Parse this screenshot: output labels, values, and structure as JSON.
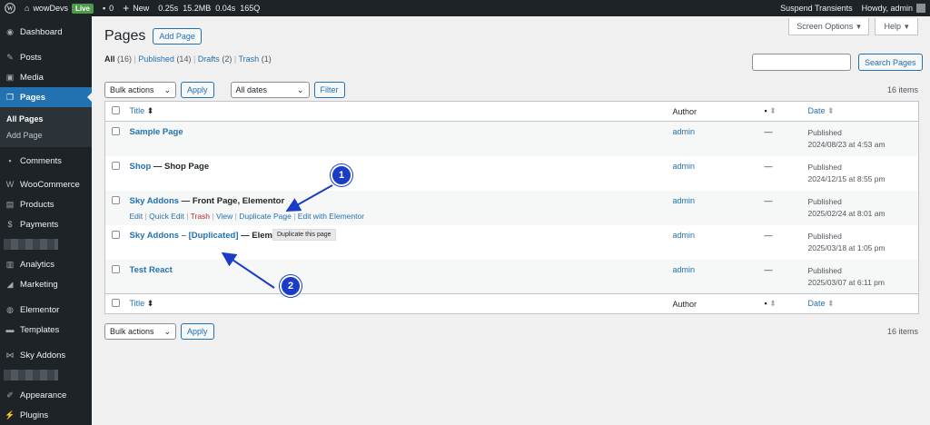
{
  "adminbar": {
    "site_name": "wowDevs",
    "live_badge": "Live",
    "comments_count": "0",
    "new_label": "New",
    "perf": "0.25s  15.2MB  0.04s  165Q",
    "suspend": "Suspend Transients",
    "howdy": "Howdy, admin"
  },
  "sidebar": {
    "dashboard": "Dashboard",
    "posts": "Posts",
    "media": "Media",
    "pages": "Pages",
    "sub_all": "All Pages",
    "sub_add": "Add Page",
    "comments": "Comments",
    "woocommerce": "WooCommerce",
    "products": "Products",
    "payments": "Payments",
    "analytics": "Analytics",
    "marketing": "Marketing",
    "elementor": "Elementor",
    "templates": "Templates",
    "skyaddons": "Sky Addons",
    "appearance": "Appearance",
    "plugins": "Plugins"
  },
  "header": {
    "title": "Pages",
    "add_button": "Add Page",
    "screen_options": "Screen Options",
    "help": "Help"
  },
  "filters": {
    "all": "All",
    "all_count": "(16)",
    "published": "Published",
    "published_count": "(14)",
    "drafts": "Drafts",
    "drafts_count": "(2)",
    "trash": "Trash",
    "trash_count": "(1)",
    "search_value": "",
    "search_button": "Search Pages",
    "bulk_actions": "Bulk actions",
    "apply": "Apply",
    "all_dates": "All dates",
    "filter": "Filter",
    "items_count": "16 items"
  },
  "table": {
    "col_title": "Title",
    "col_author": "Author",
    "col_date": "Date",
    "rows": [
      {
        "title": "Sample Page",
        "state": "",
        "author": "admin",
        "comments": "—",
        "status": "Published",
        "date": "2024/08/23 at 4:53 am"
      },
      {
        "title": "Shop",
        "state": " — Shop Page",
        "author": "admin",
        "comments": "—",
        "status": "Published",
        "date": "2024/12/15 at 8:55 pm"
      },
      {
        "title": "Sky Addons",
        "state": " — Front Page, Elementor",
        "author": "admin",
        "comments": "—",
        "status": "Published",
        "date": "2025/02/24 at 8:01 am"
      },
      {
        "title": "Sky Addons – [Duplicated]",
        "state": " — Elementor",
        "author": "admin",
        "comments": "—",
        "status": "Published",
        "date": "2025/03/18 at 1:05 pm"
      },
      {
        "title": "Test React",
        "state": "",
        "author": "admin",
        "comments": "—",
        "status": "Published",
        "date": "2025/03/07 at 6:11 pm"
      }
    ],
    "row_actions": {
      "edit": "Edit",
      "quick_edit": "Quick Edit",
      "trash": "Trash",
      "view": "View",
      "duplicate": "Duplicate Page",
      "edit_elementor": "Edit with Elementor"
    }
  },
  "tooltip": "Duplicate this page",
  "callouts": [
    "1",
    "2"
  ],
  "colors": {
    "accent": "#2271b1",
    "callout": "#1a3cc7",
    "adminbar": "#1d2327"
  }
}
